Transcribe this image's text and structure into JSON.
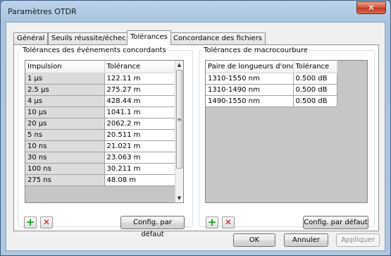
{
  "window": {
    "title": "Paramètres OTDR",
    "close_label": "✕"
  },
  "tabs": [
    {
      "label": "Général"
    },
    {
      "label": "Seuils réussite/échec"
    },
    {
      "label": "Tolérances"
    },
    {
      "label": "Concordance des fichiers"
    }
  ],
  "events_group": {
    "legend": "Tolérances des événements concordants",
    "headers": [
      "Impulsion",
      "Tolérance"
    ],
    "rows": [
      [
        "1 µs",
        "122.11 m"
      ],
      [
        "2.5 µs",
        "275.27 m"
      ],
      [
        "4 µs",
        "428.44 m"
      ],
      [
        "10 µs",
        "1041.1 m"
      ],
      [
        "20 µs",
        "2062.2 m"
      ],
      [
        "5 ns",
        "20.511 m"
      ],
      [
        "10 ns",
        "21.021 m"
      ],
      [
        "30 ns",
        "23.063 m"
      ],
      [
        "100 ns",
        "30.211 m"
      ],
      [
        "275 ns",
        "48.08 m"
      ]
    ],
    "default_button": "Config. par défaut"
  },
  "macro_group": {
    "legend": "Tolérances de macrocourbure",
    "headers": [
      "Paire de longueurs d'onde",
      "Tolérance"
    ],
    "rows": [
      [
        "1310-1550 nm",
        "0.500 dB"
      ],
      [
        "1310-1490 nm",
        "0.500 dB"
      ],
      [
        "1490-1550 nm",
        "0.500 dB"
      ]
    ],
    "default_button": "Config. par défaut"
  },
  "footer": {
    "ok": "OK",
    "cancel": "Annuler",
    "apply": "Appliquer"
  },
  "colors": {
    "add": "#1f9a1f",
    "remove": "#d01818",
    "close": "#c43a22"
  },
  "icons": {
    "add": "+",
    "remove": "✕",
    "scroll_up": "▲",
    "scroll_down": "▼",
    "grip": "≡"
  }
}
